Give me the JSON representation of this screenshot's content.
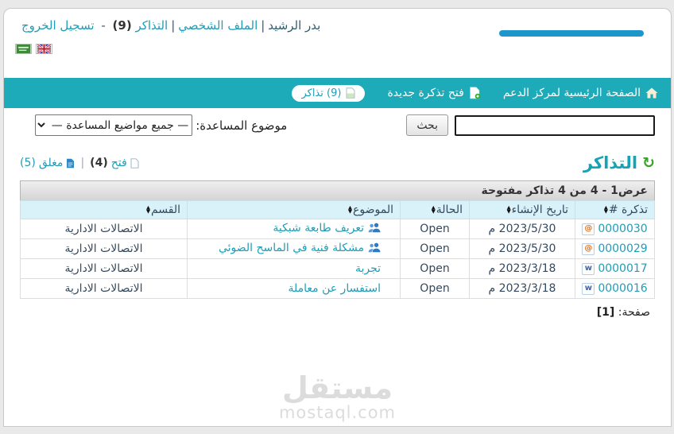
{
  "colors": {
    "navbar": "#1daab9",
    "link": "#1f9db6",
    "logo_bar": "#1d97cb",
    "header_row_bg": "#d9f1f8",
    "text_dark": "#34495e",
    "refresh_green": "#3aa32a"
  },
  "user_nav": {
    "username": "بدر الرشيد",
    "sep": "|",
    "profile_link": "الملف الشخصي",
    "tickets_link": "التذاكر",
    "tickets_count": "(9)",
    "dash": "-",
    "logout_link": "تسجيل الخروج"
  },
  "navbar": {
    "home_label": "الصفحة الرئيسية لمركز الدعم",
    "new_ticket_label": "فتح تذكرة جديدة",
    "tickets_pill_label": "(9) تذاكر"
  },
  "search": {
    "topic_label": "موضوع المساعدة:",
    "topic_selected_option": "— جميع مواضيع المساعدة —",
    "search_button_label": "بحث",
    "search_input_value": ""
  },
  "tickets_section": {
    "title": "التذاكر",
    "open_label": "فتح",
    "open_count": "(4)",
    "sep": "|",
    "closed_label": "مغلق",
    "closed_count": "(5)"
  },
  "table": {
    "caption": "عرض1 - 4 من 4 تذاكر مفتوحة",
    "columns": [
      "تذكرة #",
      "تاريخ الإنشاء",
      "الحالة",
      "الموضوع",
      "القسم"
    ],
    "rows": [
      {
        "id": "0000030",
        "date": "2023/5/30 م",
        "status": "Open",
        "subject": "تعريف طابعة شبكية",
        "dept": "الاتصالات الادارية",
        "source": "email",
        "source_glyph": "@",
        "source_icon": "email-source-icon",
        "has_collaborators": true
      },
      {
        "id": "0000029",
        "date": "2023/5/30 م",
        "status": "Open",
        "subject": "مشكلة فنية في الماسح الضوئي",
        "dept": "الاتصالات الادارية",
        "source": "email",
        "source_glyph": "@",
        "source_icon": "email-source-icon",
        "has_collaborators": true
      },
      {
        "id": "0000017",
        "date": "2023/3/18 م",
        "status": "Open",
        "subject": "تجربة",
        "dept": "الاتصالات الادارية",
        "source": "web",
        "source_glyph": "w",
        "source_icon": "web-source-icon",
        "has_collaborators": false
      },
      {
        "id": "0000016",
        "date": "2023/3/18 م",
        "status": "Open",
        "subject": "استفسار عن معاملة",
        "dept": "الاتصالات الادارية",
        "source": "web",
        "source_glyph": "w",
        "source_icon": "web-source-icon",
        "has_collaborators": false
      }
    ],
    "page_label": "صفحة:",
    "page_current": "[1]"
  },
  "watermark": {
    "logo_text": "مستقل",
    "domain": "mostaql.com"
  }
}
